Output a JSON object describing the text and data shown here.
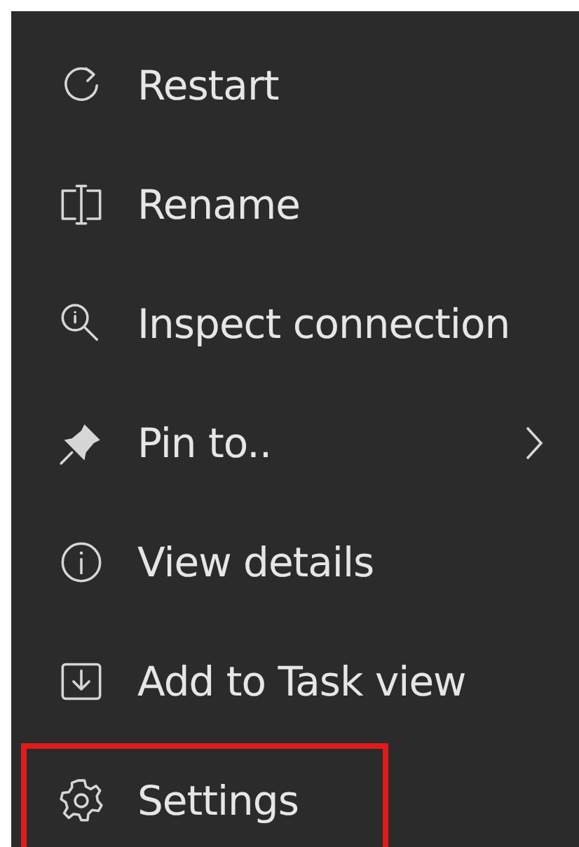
{
  "menu": {
    "items": [
      {
        "label": "Restart",
        "submenu": false,
        "highlighted": false
      },
      {
        "label": "Rename",
        "submenu": false,
        "highlighted": false
      },
      {
        "label": "Inspect connection",
        "submenu": false,
        "highlighted": false
      },
      {
        "label": "Pin to..",
        "submenu": true,
        "highlighted": false
      },
      {
        "label": "View details",
        "submenu": false,
        "highlighted": false
      },
      {
        "label": "Add to Task view",
        "submenu": false,
        "highlighted": false
      },
      {
        "label": "Settings",
        "submenu": false,
        "highlighted": true
      }
    ]
  }
}
